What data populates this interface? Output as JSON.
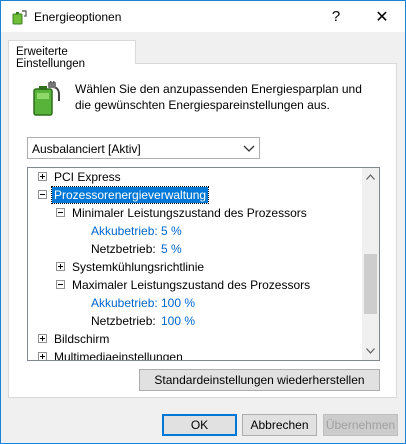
{
  "window": {
    "title": "Energieoptionen",
    "help_label": "?",
    "close_label": "✕"
  },
  "tab": {
    "label": "Erweiterte Einstellungen"
  },
  "description": "Wählen Sie den anzupassenden Energiesparplan und die gewünschten Energiespareinstellungen aus.",
  "plan_select": {
    "value": "Ausbalanciert [Aktiv]"
  },
  "tree": {
    "pci_express": "PCI Express",
    "processor": "Prozessorenergieverwaltung",
    "min_state": {
      "label": "Minimaler Leistungszustand des Prozessors",
      "battery_label": "Akkubetrieb:",
      "battery_value": "5 %",
      "ac_label": "Netzbetrieb:",
      "ac_value": "5 %"
    },
    "cooling": "Systemkühlungsrichtlinie",
    "max_state": {
      "label": "Maximaler Leistungszustand des Prozessors",
      "battery_label": "Akkubetrieb:",
      "battery_value": "100 %",
      "ac_label": "Netzbetrieb:",
      "ac_value": "100 %"
    },
    "display": "Bildschirm",
    "multimedia": "Multimediaeinstellungen"
  },
  "buttons": {
    "restore": "Standardeinstellungen wiederherstellen",
    "ok": "OK",
    "cancel": "Abbrechen",
    "apply": "Übernehmen"
  },
  "colors": {
    "accent": "#0078d7",
    "link": "#0066cc",
    "window_border": "#1883d7"
  }
}
